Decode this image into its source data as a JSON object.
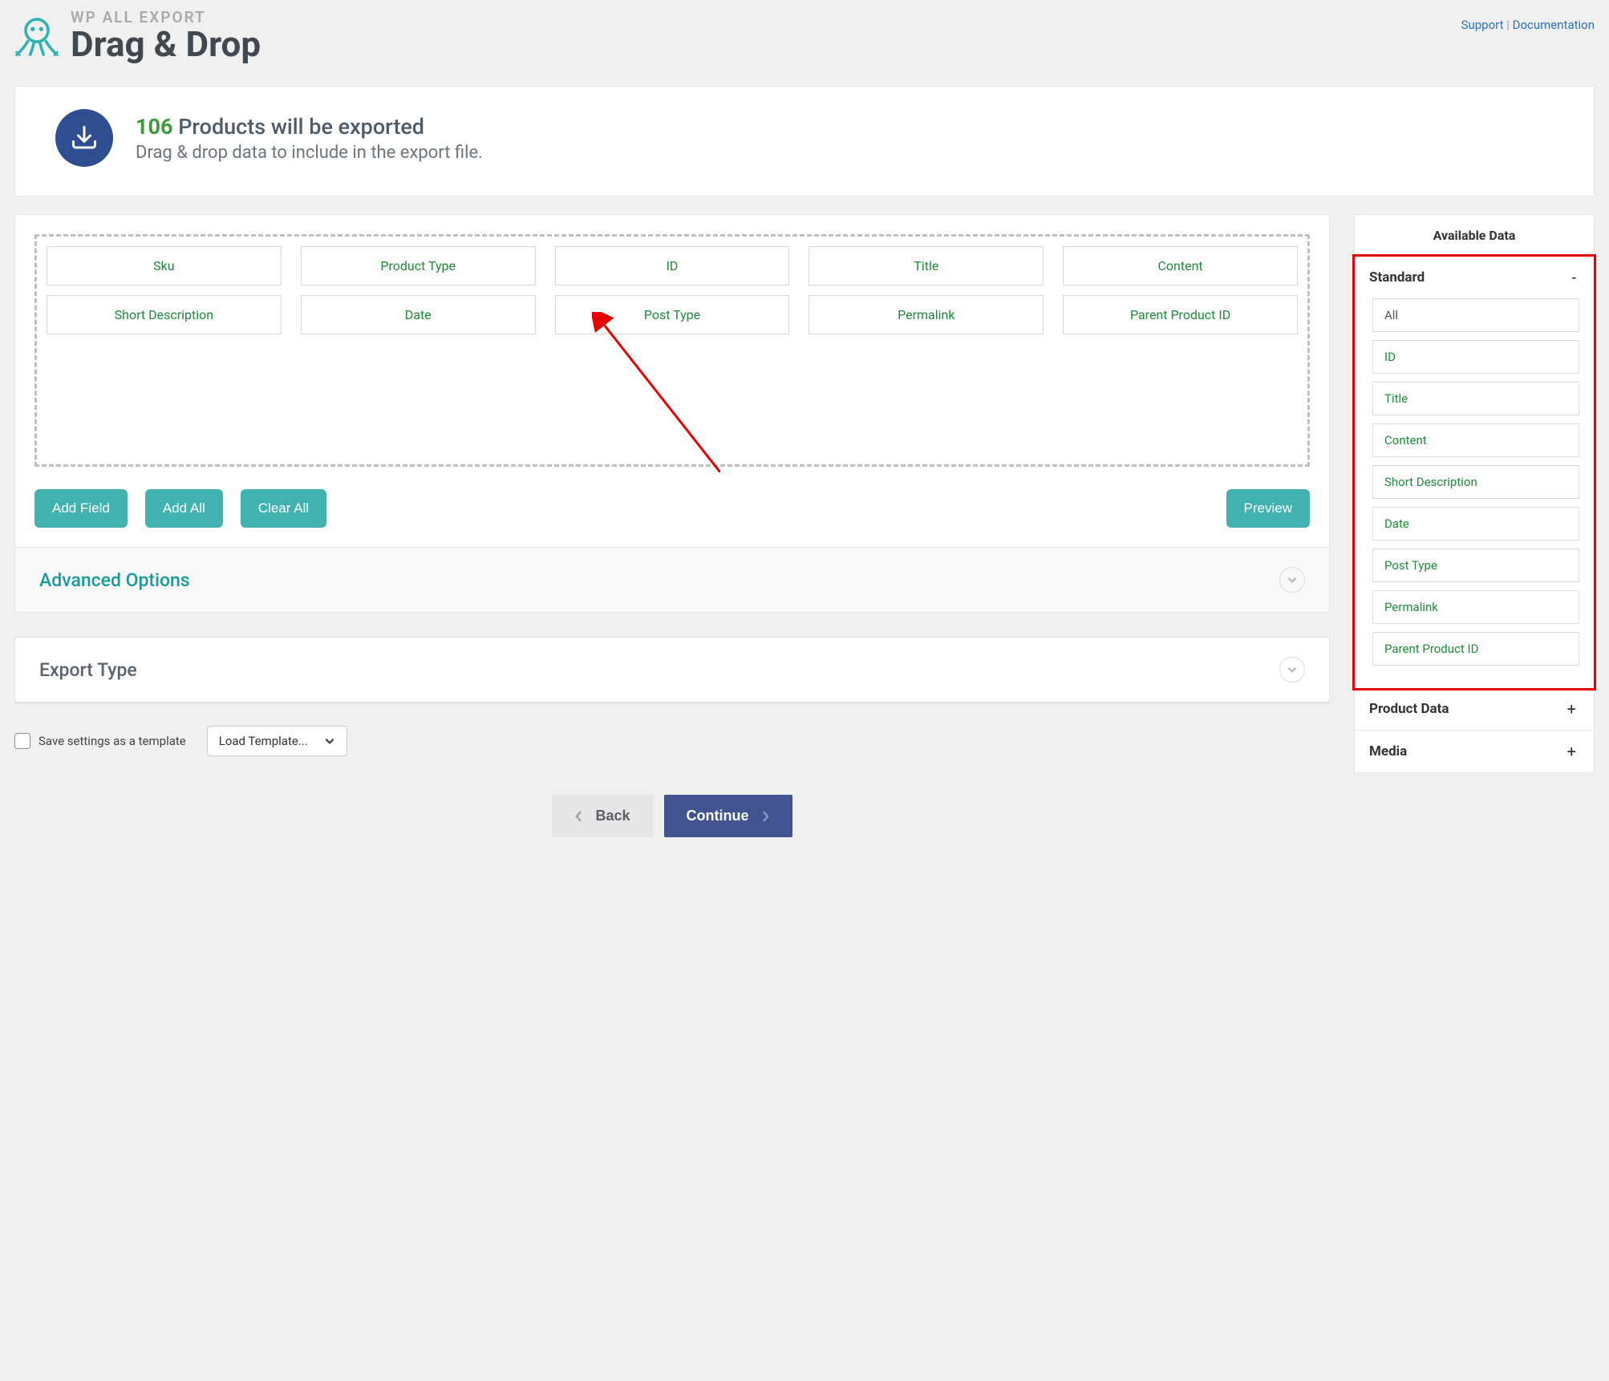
{
  "header": {
    "small": "WP ALL EXPORT",
    "big": "Drag & Drop",
    "links": {
      "support": "Support",
      "documentation": "Documentation"
    }
  },
  "summary": {
    "count": "106",
    "title_rest": " Products will be exported",
    "sub": "Drag & drop data to include in the export file."
  },
  "chips_row1": [
    "Sku",
    "Product Type",
    "ID",
    "Title",
    "Content"
  ],
  "chips_row2": [
    "Short Description",
    "Date",
    "Post Type",
    "Permalink",
    "Parent Product ID"
  ],
  "buttons": {
    "add_field": "Add Field",
    "add_all": "Add All",
    "clear_all": "Clear All",
    "preview": "Preview"
  },
  "accordions": {
    "advanced": "Advanced Options",
    "export_type": "Export Type"
  },
  "bottom": {
    "save_template": "Save settings as a template",
    "load_template": "Load Template..."
  },
  "nav": {
    "back": "Back",
    "continue": "Continue"
  },
  "sidebar": {
    "title": "Available Data",
    "sections": [
      {
        "title": "Standard",
        "expanded": true,
        "toggle": "-",
        "items": [
          "All",
          "ID",
          "Title",
          "Content",
          "Short Description",
          "Date",
          "Post Type",
          "Permalink",
          "Parent Product ID"
        ]
      },
      {
        "title": "Product Data",
        "expanded": false,
        "toggle": "+"
      },
      {
        "title": "Media",
        "expanded": false,
        "toggle": "+"
      }
    ]
  }
}
